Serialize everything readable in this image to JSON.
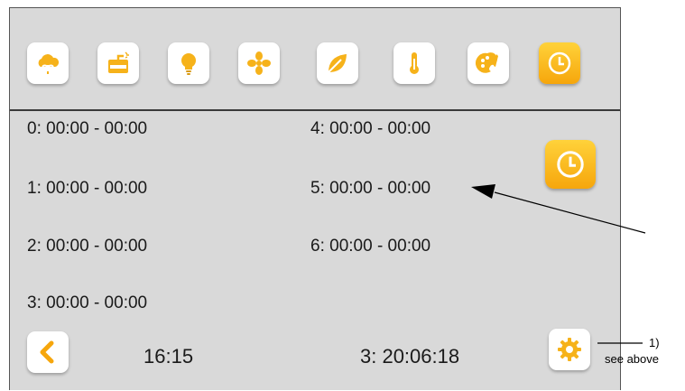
{
  "toolbar": {
    "icons": [
      "cloud-plant-icon",
      "water-tank-icon",
      "light-bulb-icon",
      "fan-icon",
      "leaf-icon",
      "thermometer-icon",
      "palette-icon",
      "clock-icon"
    ],
    "active": "clock-icon"
  },
  "slots": [
    {
      "label": "0: 00:00 - 00:00"
    },
    {
      "label": "1: 00:00 - 00:00"
    },
    {
      "label": "2: 00:00 - 00:00"
    },
    {
      "label": "3: 00:00 - 00:00"
    },
    {
      "label": "4: 00:00 - 00:00"
    },
    {
      "label": "5: 00:00 - 00:00"
    },
    {
      "label": "6: 00:00 - 00:00"
    }
  ],
  "status": {
    "time": "16:15",
    "countdown": "3: 20:06:18"
  },
  "annotation": {
    "number": "1)",
    "note": "see above"
  },
  "colors": {
    "accent_orange": "#f6a60c",
    "accent_yellow": "#ffd23a",
    "screen_bg": "#d9d9d9"
  }
}
